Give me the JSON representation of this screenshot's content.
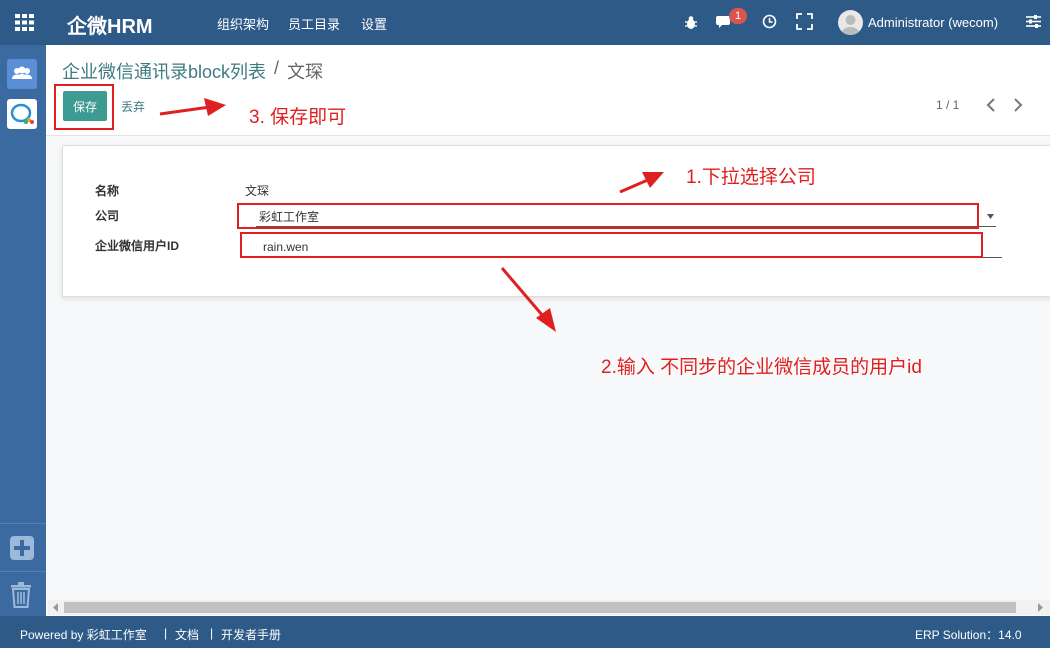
{
  "app": {
    "brand": "企微HRM",
    "menu": [
      "组织架构",
      "员工目录",
      "设置"
    ],
    "chat_badge": "1",
    "user": "Administrator (wecom)"
  },
  "breadcrumb": {
    "parent": "企业微信通讯录block列表",
    "separator": "/",
    "current": "文琛"
  },
  "toolbar": {
    "save_label": "保存",
    "discard_label": "丢弃",
    "pager": "1 / 1"
  },
  "form": {
    "name_label": "名称",
    "name_value": "文琛",
    "company_label": "公司",
    "company_value": "彩虹工作室",
    "userid_label": "企业微信用户ID",
    "userid_value": "rain.wen"
  },
  "annotations": {
    "step1": "1.下拉选择公司",
    "step2": "2.输入 不同步的企业微信成员的用户id",
    "step3": "3. 保存即可"
  },
  "footer": {
    "powered": "Powered by 彩虹工作室",
    "sep": "|",
    "docs": "文档",
    "dev_manual": "开发者手册",
    "version": "ERP Solution：14.0"
  },
  "colors": {
    "topbar": "#2e5a88",
    "sidebar": "#3b6aa0",
    "primary_button": "#3d9b92",
    "annotation": "#e02020"
  },
  "icons": [
    "apps-grid-icon",
    "bug-icon",
    "chat-icon",
    "clock-icon",
    "fullscreen-icon",
    "user-avatar-icon",
    "settings-sliders-icon",
    "employees-icon",
    "wecom-icon",
    "add-icon",
    "trash-icon",
    "chevron-left-icon",
    "chevron-right-icon"
  ]
}
